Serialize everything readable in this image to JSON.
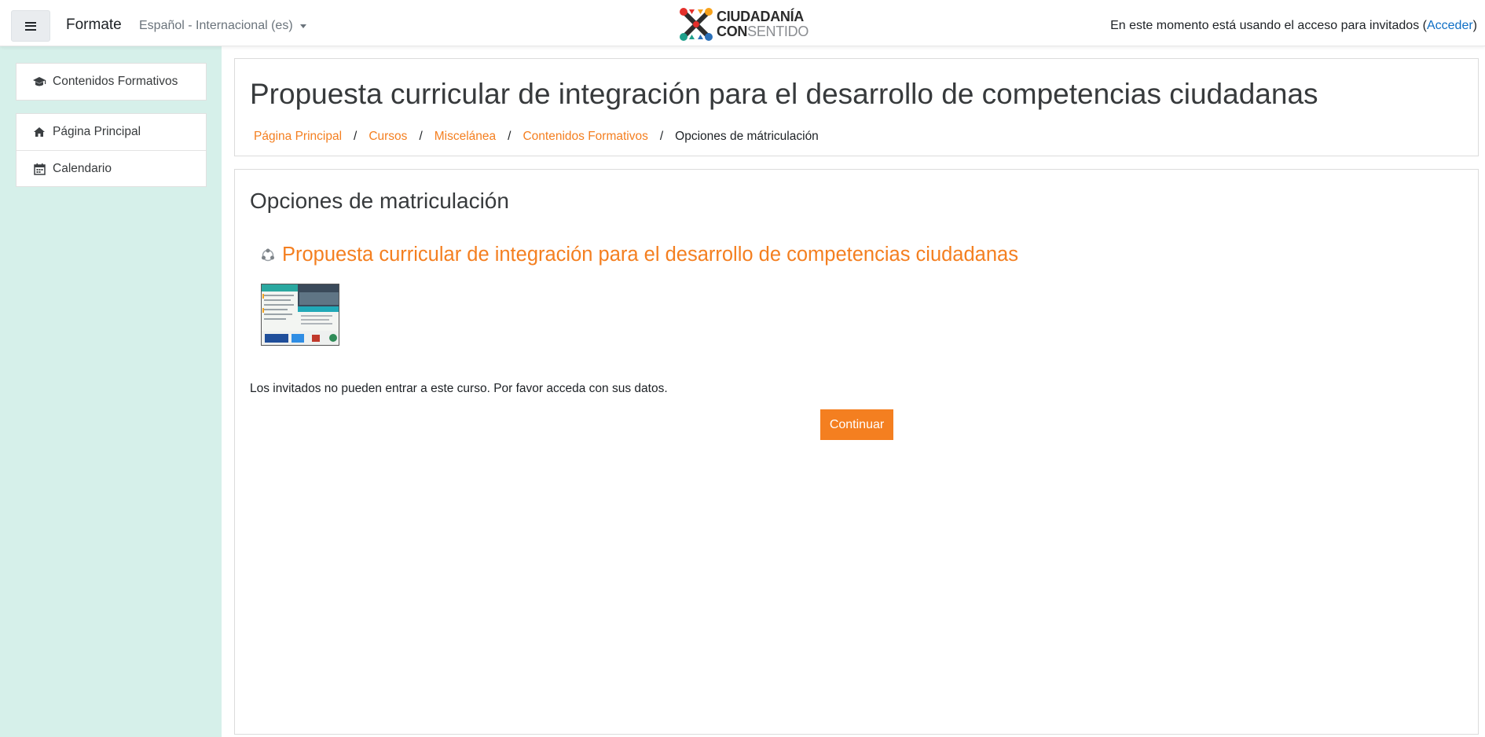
{
  "navbar": {
    "menu_icon": "hamburger-icon",
    "brand": "Formate",
    "language": "Español - Internacional (es)",
    "logo": {
      "line1": "CIUDADANÍA",
      "line2a": "CON",
      "line2b": "SENTIDO"
    },
    "guest_text": "En este momento está usando el acceso para invitados (",
    "login_link": "Acceder",
    "guest_close": ")"
  },
  "sidebar": {
    "course_item": {
      "label": "Contenidos Formativos",
      "icon": "graduation-cap-icon"
    },
    "items": [
      {
        "label": "Página Principal",
        "icon": "home-icon"
      },
      {
        "label": "Calendario",
        "icon": "calendar-icon"
      }
    ]
  },
  "header": {
    "title": "Propuesta curricular de integración para el desarrollo de competencias ciudadanas",
    "breadcrumb": [
      {
        "label": "Página Principal"
      },
      {
        "label": "Cursos"
      },
      {
        "label": "Miscelánea"
      },
      {
        "label": "Contenidos Formativos"
      },
      {
        "label": "Opciones de mátriculación"
      }
    ],
    "separator": "/"
  },
  "main": {
    "section_title": "Opciones de matriculación",
    "course_name": "Propuesta curricular de integración para el desarrollo de competencias ciudadanas",
    "course_icon": "course-icon",
    "guest_message": "Los invitados no pueden entrar a este curso. Por favor acceda con sus datos.",
    "continue_label": "Continuar"
  },
  "colors": {
    "accent": "#f47f20",
    "link_blue": "#0f6fc5",
    "drawer_bg": "#d6f0ea"
  }
}
